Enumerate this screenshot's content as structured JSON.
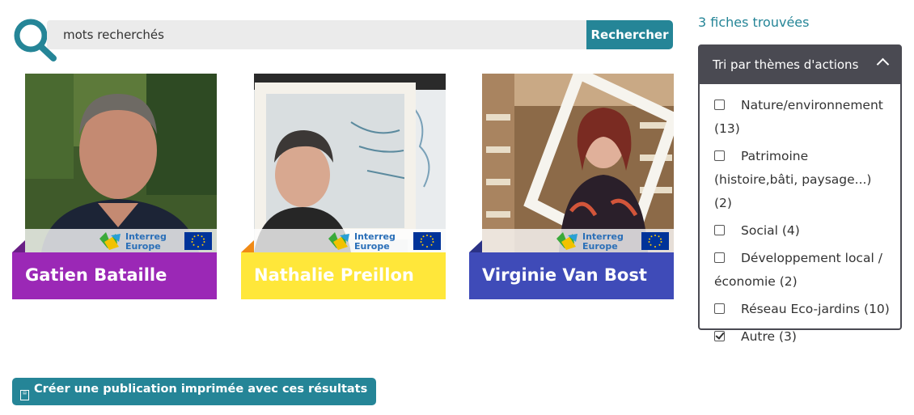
{
  "search": {
    "value": "mots recherchés",
    "button_label": "Rechercher"
  },
  "results_count": "3 fiches trouvées",
  "filter": {
    "title": "Tri par thèmes d'actions",
    "items": [
      {
        "label": "Nature/environnement (13)",
        "checked": false
      },
      {
        "label": "Patrimoine (histoire,bâti, paysage...) (2)",
        "checked": false
      },
      {
        "label": "Social (4)",
        "checked": false
      },
      {
        "label": "Développement local / économie (2)",
        "checked": false
      },
      {
        "label": "Réseau Eco-jardins (10)",
        "checked": false
      },
      {
        "label": "Autre (3)",
        "checked": true
      }
    ]
  },
  "cards": [
    {
      "name": "Gatien Bataille",
      "color": "#9b28b6",
      "fold_color": "#6a1f86"
    },
    {
      "name": "Nathalie Preillon",
      "color": "#ffe73a",
      "fold_color": "#f08a16"
    },
    {
      "name": "Virginie Van Bost",
      "color": "#3f4bb8",
      "fold_color": "#2b3286"
    }
  ],
  "logo": {
    "line1": "Interreg",
    "line2": "Europe"
  },
  "print_button": {
    "label": "Créer une publication imprimée avec ces résultats"
  },
  "icons": [
    "search-icon",
    "chevron-up-icon",
    "checkbox-icon",
    "print-icon",
    "interreg-logo",
    "eu-flag-icon"
  ]
}
